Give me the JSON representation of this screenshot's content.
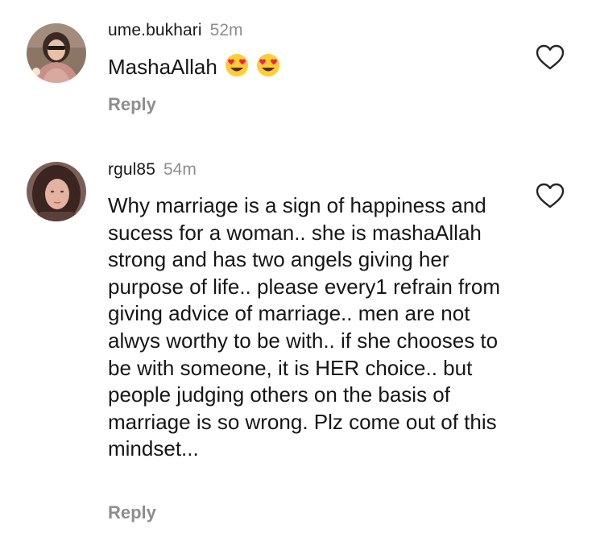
{
  "comments": [
    {
      "username": "ume.bukhari",
      "time": "52m",
      "text": "MashaAllah",
      "emojis": [
        "smiling-face-with-heart-eyes",
        "smiling-face-with-heart-eyes"
      ],
      "reply_label": "Reply"
    },
    {
      "username": "rgul85",
      "time": "54m",
      "text": "Why marriage is a sign of happiness and sucess for a woman.. she is mashaAllah strong and has two angels giving her purpose of life.. please every1 refrain from giving advice of marriage.. men are not alwys worthy to be with.. if she chooses to be with someone, it is HER choice.. but people judging others on the basis of marriage is so wrong. Plz come out of this mindset...",
      "reply_label": "Reply"
    }
  ],
  "colors": {
    "text": "#161616",
    "muted": "#8e8e8e",
    "background": "#ffffff",
    "emoji_face": "#ffcc33",
    "emoji_heart": "#e8264a"
  }
}
